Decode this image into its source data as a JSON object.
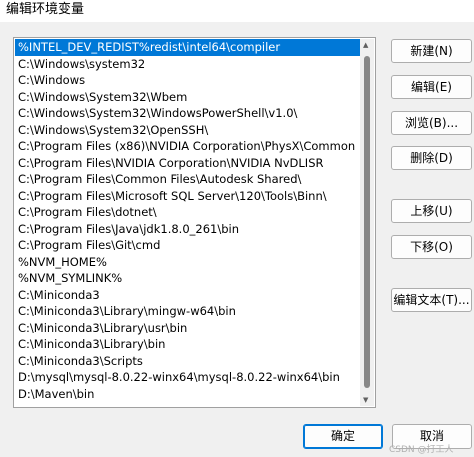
{
  "window": {
    "title": "编辑环境变量"
  },
  "path_list": {
    "items": [
      "%INTEL_DEV_REDIST%redist\\intel64\\compiler",
      "C:\\Windows\\system32",
      "C:\\Windows",
      "C:\\Windows\\System32\\Wbem",
      "C:\\Windows\\System32\\WindowsPowerShell\\v1.0\\",
      "C:\\Windows\\System32\\OpenSSH\\",
      "C:\\Program Files (x86)\\NVIDIA Corporation\\PhysX\\Common",
      "C:\\Program Files\\NVIDIA Corporation\\NVIDIA NvDLISR",
      "C:\\Program Files\\Common Files\\Autodesk Shared\\",
      "C:\\Program Files\\Microsoft SQL Server\\120\\Tools\\Binn\\",
      "C:\\Program Files\\dotnet\\",
      "C:\\Program Files\\Java\\jdk1.8.0_261\\bin",
      "C:\\Program Files\\Git\\cmd",
      "%NVM_HOME%",
      "%NVM_SYMLINK%",
      "C:\\Miniconda3",
      "C:\\Miniconda3\\Library\\mingw-w64\\bin",
      "C:\\Miniconda3\\Library\\usr\\bin",
      "C:\\Miniconda3\\Library\\bin",
      "C:\\Miniconda3\\Scripts",
      "D:\\mysql\\mysql-8.0.22-winx64\\mysql-8.0.22-winx64\\bin",
      "D:\\Maven\\bin"
    ],
    "selected_index": 0
  },
  "buttons": {
    "new": "新建(N)",
    "edit": "编辑(E)",
    "browse": "浏览(B)...",
    "delete": "删除(D)",
    "move_up": "上移(U)",
    "move_down": "下移(O)",
    "edit_text": "编辑文本(T)...",
    "ok": "确定",
    "cancel": "取消"
  },
  "watermark": "CSDN @打工人"
}
